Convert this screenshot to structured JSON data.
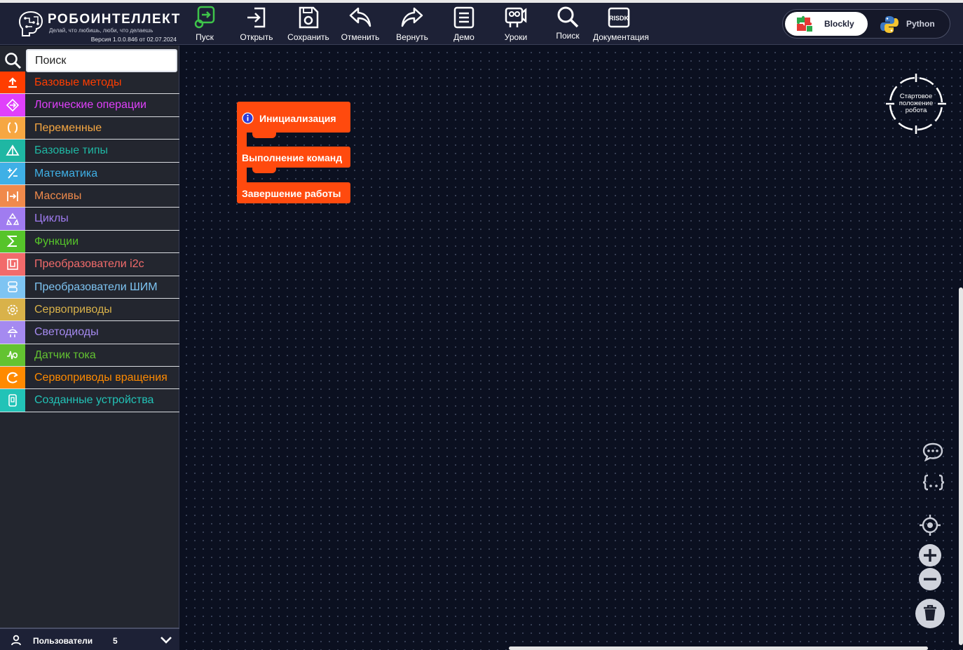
{
  "logo": {
    "name": "РОБОИНТЕЛЛЕКТ",
    "slogan": "Делай, что любишь, люби, что делаешь",
    "version": "Версия 1.0.0.846 от 02.07.2024"
  },
  "toolbar": {
    "run": "Пуск",
    "open": "Открыть",
    "save": "Сохранить",
    "undo": "Отменить",
    "redo": "Вернуть",
    "demo": "Демо",
    "lessons": "Уроки",
    "search": "Поиск",
    "docs": "Документация",
    "docs_icon_text": "RISDK"
  },
  "mode": {
    "blockly": "Blockly",
    "python": "Python",
    "active": "Blockly"
  },
  "sidebar": {
    "search_placeholder": "Поиск",
    "categories": [
      {
        "label": "Базовые методы",
        "color": "#ff3d00",
        "icon": "upload-icon"
      },
      {
        "label": "Логические операции",
        "color": "#e040fb",
        "icon": "logic-icon"
      },
      {
        "label": "Переменные",
        "color": "#f6a742",
        "icon": "variables-icon"
      },
      {
        "label": "Базовые типы",
        "color": "#1fb7a3",
        "icon": "types-icon"
      },
      {
        "label": "Математика",
        "color": "#3fb0e6",
        "icon": "math-icon"
      },
      {
        "label": "Массивы",
        "color": "#f08a4b",
        "icon": "arrays-icon"
      },
      {
        "label": "Циклы",
        "color": "#a07cf0",
        "icon": "loops-icon"
      },
      {
        "label": "Функции",
        "color": "#56c42a",
        "icon": "functions-icon"
      },
      {
        "label": "Преобразователи i2c",
        "color": "#f26b6b",
        "icon": "i2c-icon"
      },
      {
        "label": "Преобразователи ШИМ",
        "color": "#7ec4f2",
        "icon": "pwm-icon"
      },
      {
        "label": "Сервоприводы",
        "color": "#d9b24a",
        "icon": "servo-icon"
      },
      {
        "label": "Светодиоды",
        "color": "#a58af0",
        "icon": "led-icon"
      },
      {
        "label": "Датчик тока",
        "color": "#63c331",
        "icon": "current-sensor-icon"
      },
      {
        "label": "Сервоприводы вращения",
        "color": "#ff8a00",
        "icon": "rotation-servo-icon"
      },
      {
        "label": "Созданные устройства",
        "color": "#22c3b7",
        "icon": "devices-icon"
      }
    ],
    "users_label": "Пользователи",
    "users_count": "5"
  },
  "workspace": {
    "blocks": {
      "init": "Инициализация",
      "exec": "Выполнение команд",
      "finish": "Завершение работы"
    },
    "block_color": "#ff4a0e",
    "start_position_label": "Стартовое положение робота"
  },
  "colors": {
    "header_bg": "#1d2136",
    "sidebar_bg": "#23262f",
    "workspace_bg": "#0b1020"
  }
}
